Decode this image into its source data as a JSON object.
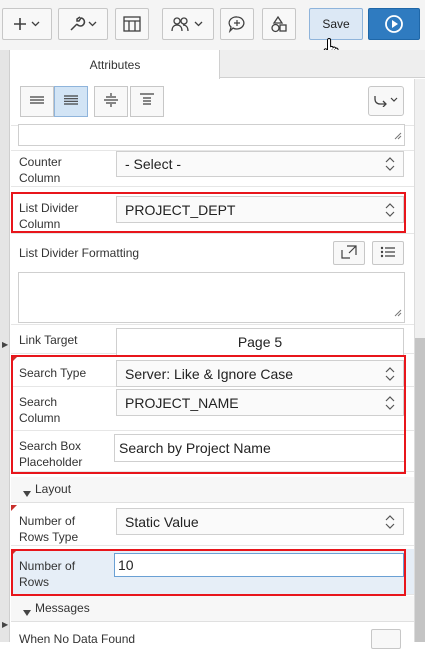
{
  "toolbar": {
    "create_icon": "plus-icon",
    "utilities_icon": "wrench-icon",
    "shared_components_icon": "grid-icon",
    "team_icon": "users-icon",
    "comments_icon": "comment-icon",
    "shapes_icon": "shapes-icon",
    "save_label": "Save",
    "run_icon": "play-icon"
  },
  "tabs": [
    {
      "label": "Attributes",
      "active": true
    },
    {
      "label": "",
      "active": false
    }
  ],
  "align_buttons": [
    {
      "icon": "align-left-icon",
      "active": false
    },
    {
      "icon": "align-justify-icon",
      "active": true
    },
    {
      "icon": "align-center-vertical-icon",
      "active": false
    },
    {
      "icon": "align-top-icon",
      "active": false
    }
  ],
  "properties": {
    "counter_column": {
      "label": "Counter Column",
      "value": "- Select -"
    },
    "list_divider_column": {
      "label": "List Divider Column",
      "value": "PROJECT_DEPT"
    },
    "list_divider_formatting": {
      "label": "List Divider Formatting"
    },
    "link_target": {
      "label": "Link Target",
      "value": "Page 5"
    },
    "search_type": {
      "label": "Search Type",
      "value": "Server: Like & Ignore Case"
    },
    "search_column": {
      "label": "Search Column",
      "value": "PROJECT_NAME"
    },
    "search_box_placeholder": {
      "label": "Search Box Placeholder",
      "value": "Search by Project Name"
    },
    "number_of_rows_type": {
      "label": "Number of Rows Type",
      "value": "Static Value"
    },
    "number_of_rows": {
      "label": "Number of Rows",
      "value": "10"
    },
    "when_no_data_found": {
      "label": "When No Data Found"
    }
  },
  "sections": {
    "layout": "Layout",
    "messages": "Messages"
  },
  "colors": {
    "highlight": "#e8151b",
    "accent": "#2f7bc0"
  }
}
